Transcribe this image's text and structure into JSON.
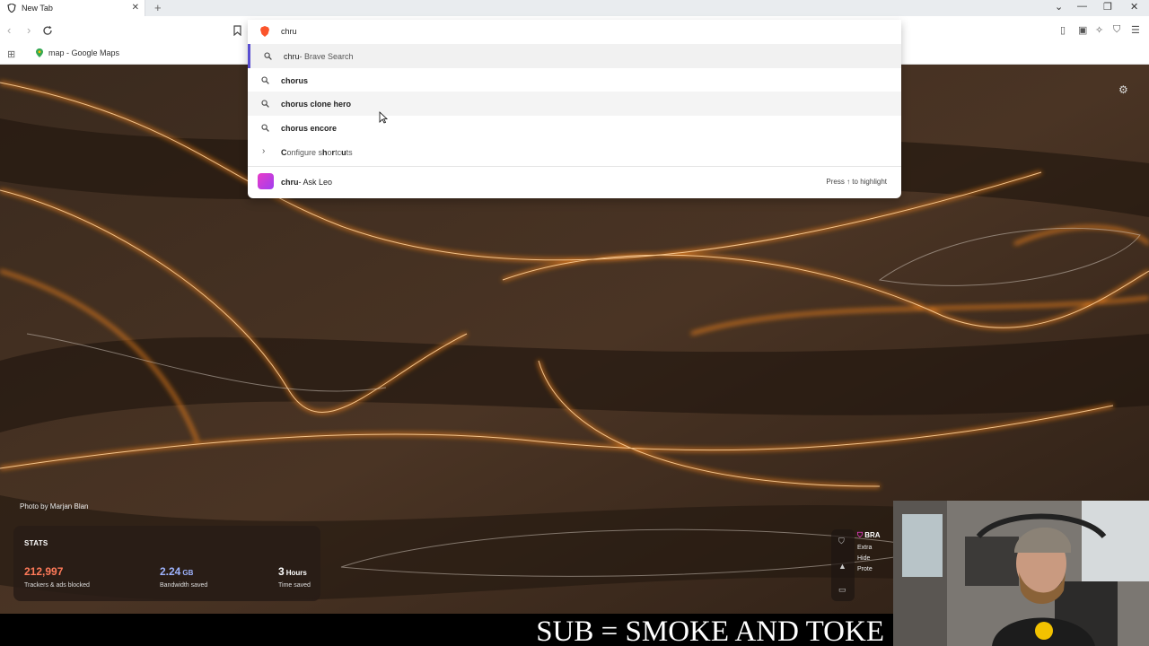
{
  "browser": {
    "tab_title": "New Tab",
    "new_tab_symbol": "+",
    "close_symbol": "✕"
  },
  "bookmarks": [
    {
      "label": "map - Google Maps"
    }
  ],
  "omnibox": {
    "query": "chru",
    "suggestions": [
      {
        "bold": "chru",
        "rest": " - Brave Search",
        "selected": true
      },
      {
        "bold": "chorus",
        "rest": ""
      },
      {
        "bold": "chorus clone hero",
        "rest": ""
      },
      {
        "bold": "chorus encore",
        "rest": ""
      }
    ],
    "shortcuts": {
      "parts": [
        "C",
        "onfigure s",
        "h",
        "o",
        "r",
        "tc",
        "u",
        "ts"
      ]
    },
    "leo": {
      "query": "chru",
      "suffix": " - Ask Leo",
      "hint": "Press ↑ to highlight"
    }
  },
  "background": {
    "credit": "Photo by Marjan Blan"
  },
  "stats": {
    "title": "STATS",
    "trackers": {
      "value": "212,997",
      "label": "Trackers & ads blocked"
    },
    "bandwidth": {
      "value": "2.24",
      "unit": "GB",
      "label": "Bandwidth saved"
    },
    "time": {
      "value": "3",
      "unit": "Hours",
      "label": "Time saved"
    }
  },
  "brave_card": {
    "head": "BRA",
    "lines": [
      "Extra",
      "Hide",
      "Prote"
    ]
  },
  "caption": {
    "text": "SUB = SMOKE AND TOKE"
  },
  "colors": {
    "stats_trackers": "#ff7a59",
    "stats_bandwidth": "#9fb4ff",
    "selected_accent": "#5a4fd1"
  }
}
